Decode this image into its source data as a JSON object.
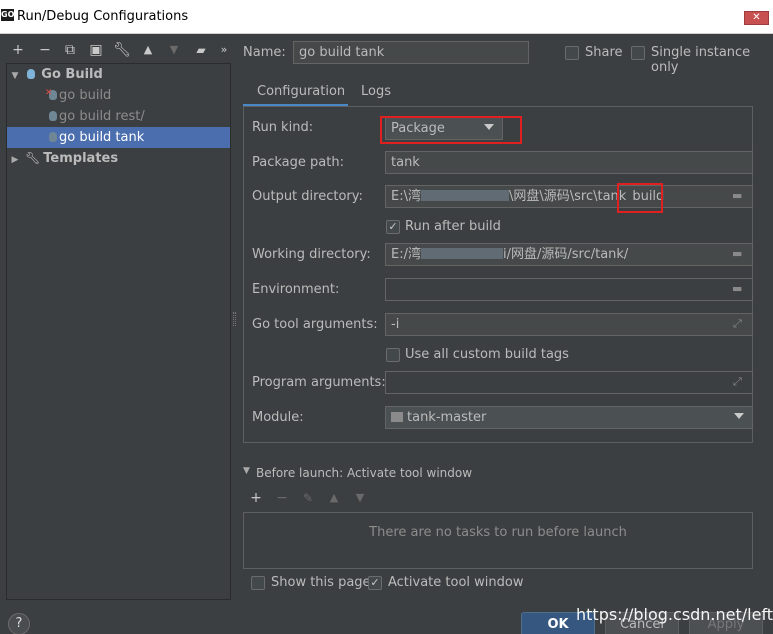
{
  "window": {
    "title": "Run/Debug Configurations",
    "app_icon_text": "GO"
  },
  "toolbar": {
    "icons": [
      "add-icon",
      "remove-icon",
      "copy-icon",
      "save-icon",
      "wrench-icon",
      "move-up-icon",
      "move-down-icon",
      "folder-add-icon",
      "more-icon"
    ]
  },
  "tree": {
    "group": "Go Build",
    "items": [
      "go build",
      "go build rest/",
      "go build tank"
    ],
    "templates": "Templates"
  },
  "header": {
    "name_label": "Name:",
    "name_value": "go build tank",
    "share_label": "Share",
    "single_instance_label": "Single instance only"
  },
  "tabs": [
    "Configuration",
    "Logs"
  ],
  "form": {
    "run_kind_label": "Run kind:",
    "run_kind_value": "Package",
    "package_path_label": "Package path:",
    "package_path_value": "tank",
    "output_dir_label": "Output directory:",
    "output_dir_prefix": "E:\\湾",
    "output_dir_mid": "\\网盘\\源码\\src\\tank",
    "output_dir_suffix": "build",
    "run_after_build_label": "Run after build",
    "working_dir_label": "Working directory:",
    "working_dir_prefix": "E:/湾",
    "working_dir_suffix": "i/网盘/源码/src/tank/",
    "environment_label": "Environment:",
    "go_tool_args_label": "Go tool arguments:",
    "go_tool_args_value": "-i",
    "custom_build_tags_label": "Use all custom build tags",
    "program_args_label": "Program arguments:",
    "module_label": "Module:",
    "module_value": "tank-master"
  },
  "before_launch": {
    "title": "Before launch: Activate tool window",
    "empty_text": "There are no tasks to run before launch",
    "show_page_label": "Show this page",
    "activate_tool_label": "Activate tool window"
  },
  "buttons": {
    "ok": "OK",
    "cancel": "Cancel",
    "apply": "Apply",
    "help": "?"
  },
  "watermark": "https://blog.csdn.net/leftfist",
  "colors": {
    "accent": "#4b6eaf",
    "highlight_box": "#e02020",
    "background": "#3c3f41"
  }
}
